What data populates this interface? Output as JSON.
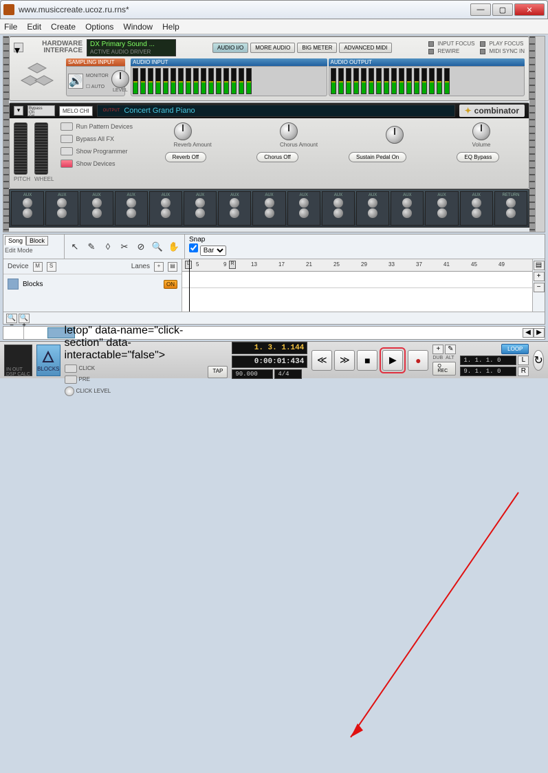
{
  "window": {
    "title": "www.musiccreate.ucoz.ru.rns*"
  },
  "menu": [
    "File",
    "Edit",
    "Create",
    "Options",
    "Window",
    "Help"
  ],
  "hwi": {
    "title1": "HARDWARE",
    "title2": "INTERFACE",
    "driver": "DX Primary Sound ...",
    "driver_sub": "ACTIVE AUDIO DRIVER",
    "btns": [
      "AUDIO I/O",
      "MORE AUDIO",
      "BIG METER",
      "ADVANCED MIDI"
    ],
    "leds": {
      "input_focus": "INPUT FOCUS",
      "rewire": "REWIRE",
      "play_focus": "PLAY FOCUS",
      "midi_sync": "MIDI SYNC IN"
    },
    "sampling": "SAMPLING INPUT",
    "monitor": "MONITOR",
    "auto": "AUTO",
    "level": "LEVEL",
    "audio_in": "AUDIO INPUT",
    "audio_out": "AUDIO OUTPUT"
  },
  "comb": {
    "patch": "MELO CHI",
    "display": "Concert Grand Piano",
    "brand": "combinator",
    "wheels": {
      "pitch": "PITCH",
      "wheel": "WHEEL"
    },
    "buttons": [
      "Run Pattern Devices",
      "Bypass All FX",
      "Show Programmer",
      "Show Devices"
    ],
    "knobs": [
      "Reverb Amount",
      "Chorus Amount",
      "",
      "Volume"
    ],
    "pills": [
      "Reverb Off",
      "Chorus Off",
      "Sustain Pedal On",
      "EQ Bypass"
    ]
  },
  "mixer": {
    "aux": "AUX",
    "return": "RETURN",
    "channels": 14
  },
  "seq": {
    "song": "Song",
    "block": "Block",
    "edit": "Edit Mode",
    "snap_label": "Snap",
    "snap_value": "Bar",
    "device": "Device",
    "lanes": "Lanes",
    "m": "M",
    "s": "S",
    "track": "Blocks",
    "on": "ON",
    "markers": {
      "L": "L",
      "R": "R"
    },
    "ticks": [
      "5",
      "9",
      "13",
      "17",
      "21",
      "25",
      "29",
      "33",
      "37",
      "41",
      "45",
      "49"
    ]
  },
  "transport": {
    "insp": "IN OUT DSP CALC",
    "blocks": "BLOCKS",
    "click": "CLICK",
    "pre": "PRE",
    "click_level": "CLICK LEVEL",
    "tap": "TAP",
    "pos": "1. 3. 1.144",
    "time": "0:00:01:434",
    "tempo": "90.000",
    "sig": "4/4",
    "dub": "DUB",
    "alt": "ALT",
    "qrec": "Q REC",
    "loop": "LOOP",
    "loopL": "1. 1. 1.  0",
    "loopR": "9. 1. 1.  0"
  }
}
